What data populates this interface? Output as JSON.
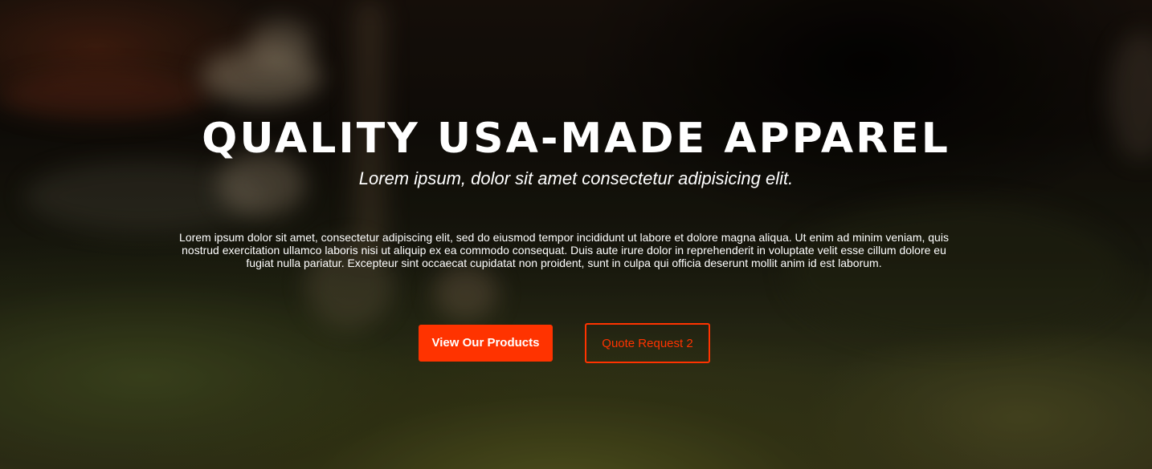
{
  "hero": {
    "title": "QUALITY USA-MADE APPAREL",
    "subtitle": "Lorem ipsum, dolor sit amet consectetur adipisicing elit.",
    "body": "Lorem ipsum dolor sit amet, consectetur adipiscing elit, sed do eiusmod tempor incididunt ut labore et dolore magna aliqua. Ut enim ad minim veniam, quis nostrud exercitation ullamco laboris nisi ut aliquip ex ea commodo consequat. Duis aute irure dolor in reprehenderit in voluptate velit esse cillum dolore eu fugiat nulla pariatur. Excepteur sint occaecat cupidatat non proident, sunt in culpa qui officia deserunt mollit anim id est laborum.",
    "buttons": {
      "primary_label": "View Our Products",
      "secondary_label": "Quote Request 2"
    }
  },
  "colors": {
    "accent": "#ff3300",
    "text": "#ffffff"
  }
}
